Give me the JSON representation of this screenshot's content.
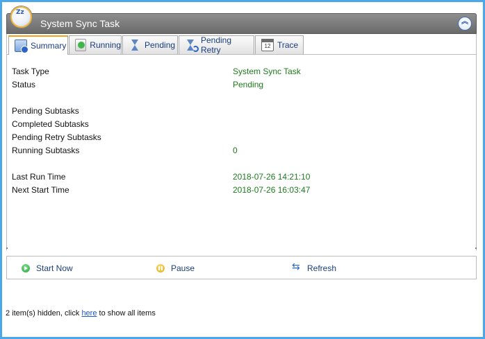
{
  "window": {
    "title": "System Sync Task",
    "logo_text": "Zz"
  },
  "tabs": [
    {
      "label": "Summary",
      "icon": "summary-icon",
      "active": true
    },
    {
      "label": "Running",
      "icon": "running-icon",
      "active": false
    },
    {
      "label": "Pending",
      "icon": "hourglass-icon",
      "active": false
    },
    {
      "label": "Pending Retry",
      "icon": "hourglass-retry-icon",
      "active": false
    },
    {
      "label": "Trace",
      "icon": "calendar-icon",
      "active": false
    }
  ],
  "trace_icon_text": "12",
  "summary": {
    "task_type_label": "Task Type",
    "task_type_value": "System Sync Task",
    "status_label": "Status",
    "status_value": "Pending",
    "pending_subtasks_label": "Pending Subtasks",
    "completed_subtasks_label": "Completed Subtasks",
    "pending_retry_subtasks_label": "Pending Retry Subtasks",
    "running_subtasks_label": "Running Subtasks",
    "running_subtasks_value": "0",
    "last_run_time_label": "Last Run Time",
    "last_run_time_value": "2018-07-26 14:21:10",
    "next_start_time_label": "Next Start Time",
    "next_start_time_value": "2018-07-26 16:03:47"
  },
  "actions": {
    "start_now": "Start Now",
    "pause": "Pause",
    "refresh": "Refresh"
  },
  "footer": {
    "prefix": "2 item(s) hidden, click ",
    "link": "here",
    "suffix": " to show all items"
  },
  "colors": {
    "frame_border": "#49a7ea",
    "value_text": "#1c7a1c",
    "active_tab_accent": "#f2a01c",
    "link": "#1a56c8"
  }
}
